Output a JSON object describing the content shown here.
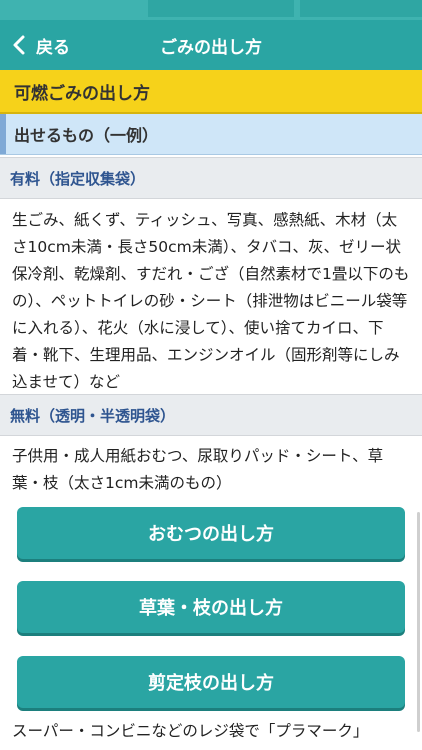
{
  "navbar": {
    "back_label": "戻る",
    "title": "ごみの出し方"
  },
  "section": {
    "title": "可燃ごみの出し方"
  },
  "subsection": {
    "title": "出せるもの（一例）"
  },
  "paid": {
    "heading": "有料（指定収集袋）",
    "text": "生ごみ、紙くず、ティッシュ、写真、感熱紙、木材（太さ10cm未満・長さ50cm未満）、タバコ、灰、ゼリー状保冷剤、乾燥剤、すだれ・ござ（自然素材で1畳以下のもの）、ペットトイレの砂・シート（排泄物はビニール袋等に入れる）、花火（水に浸して）、使い捨てカイロ、下着・靴下、生理用品、エンジンオイル（固形剤等にしみ込ませて）など"
  },
  "free": {
    "heading": "無料（透明・半透明袋）",
    "text": "子供用・成人用紙おむつ、尿取りパッド・シート、草葉・枝（太さ1cm未満のもの）"
  },
  "buttons": {
    "diaper": "おむつの出し方",
    "grass": "草葉・枝の出し方",
    "pruned": "剪定枝の出し方"
  },
  "footer_text": "スーパー・コンビニなどのレジ袋で「プラマーク」"
}
